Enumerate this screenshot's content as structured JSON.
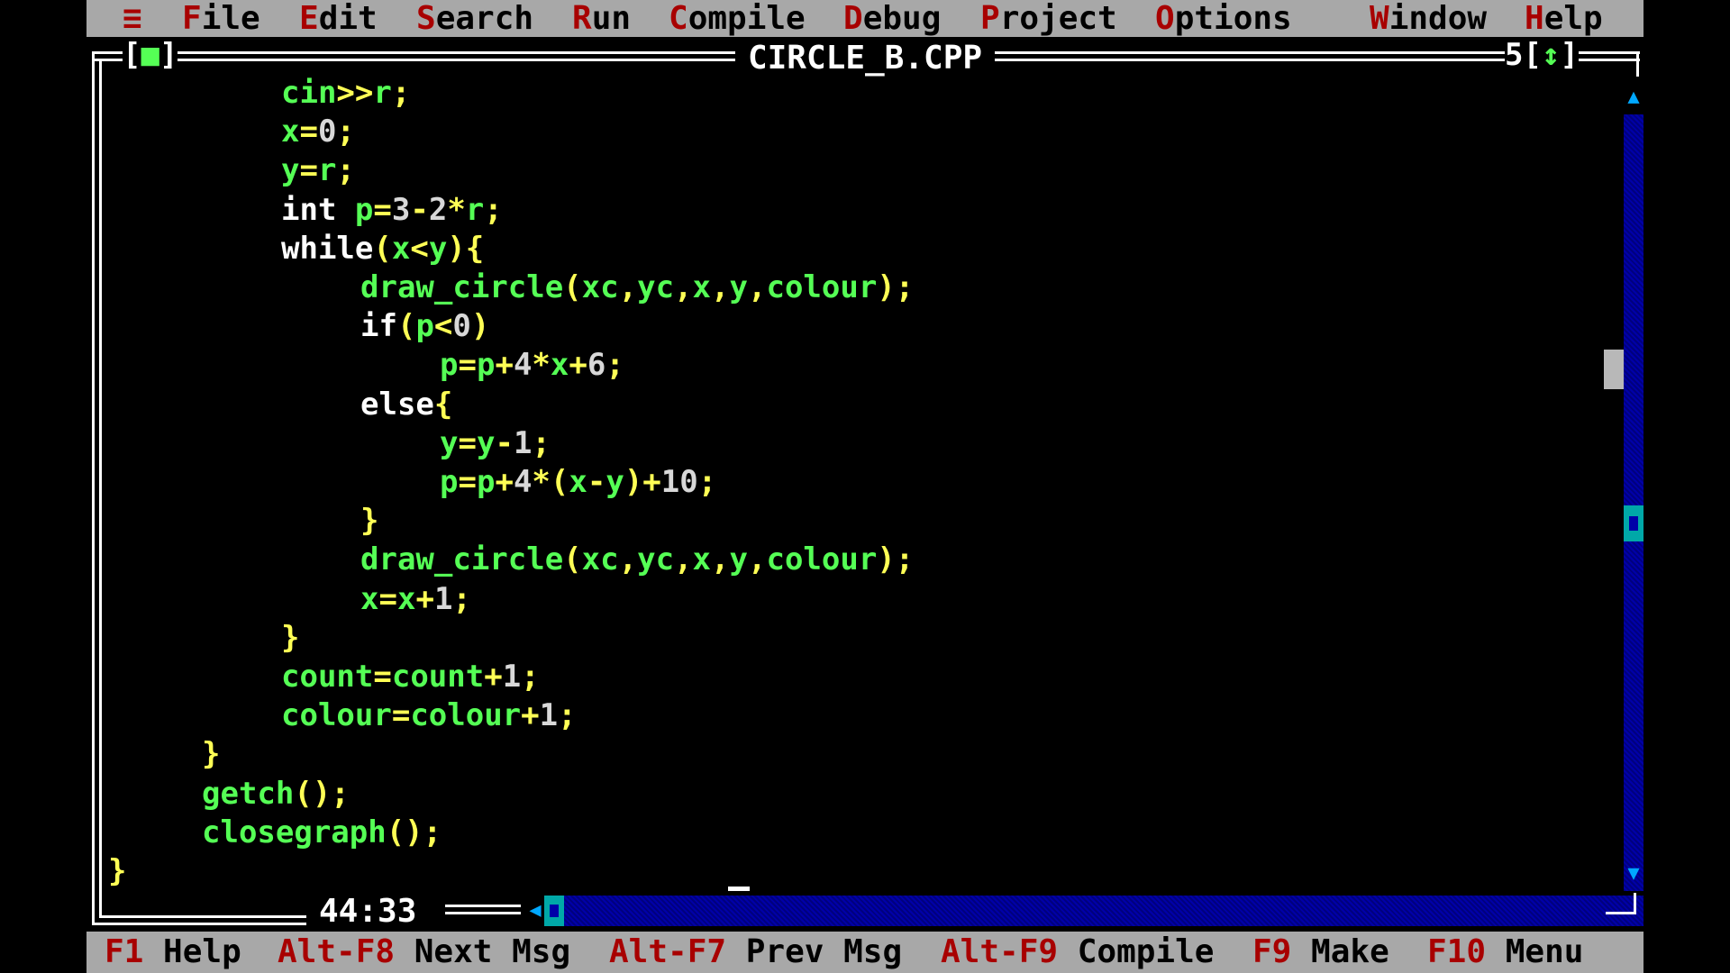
{
  "menu": {
    "system_icon": "≡",
    "items": [
      {
        "hot": "F",
        "rest": "ile"
      },
      {
        "hot": "E",
        "rest": "dit"
      },
      {
        "hot": "S",
        "rest": "earch"
      },
      {
        "hot": "R",
        "rest": "un"
      },
      {
        "hot": "C",
        "rest": "ompile"
      },
      {
        "hot": "D",
        "rest": "ebug"
      },
      {
        "hot": "P",
        "rest": "roject"
      },
      {
        "hot": "O",
        "rest": "ptions"
      },
      {
        "hot": "W",
        "rest": "indow"
      },
      {
        "hot": "H",
        "rest": "elp"
      }
    ]
  },
  "window": {
    "title": "CIRCLE_B.CPP",
    "close_box_left": "[",
    "close_box_glyph": "■",
    "close_box_right": "]",
    "number": "5",
    "zoom_box_left": "[",
    "zoom_box_glyph": "↕",
    "zoom_box_right": "]"
  },
  "code": [
    {
      "tokens": [
        [
          "id",
          "cin"
        ],
        [
          "op",
          ">>"
        ],
        [
          "id",
          "r"
        ],
        [
          "op",
          ";"
        ]
      ]
    },
    {
      "tokens": [
        [
          "id",
          "x"
        ],
        [
          "op",
          "="
        ],
        [
          "num",
          "0"
        ],
        [
          "op",
          ";"
        ]
      ]
    },
    {
      "tokens": [
        [
          "id",
          "y"
        ],
        [
          "op",
          "="
        ],
        [
          "id",
          "r"
        ],
        [
          "op",
          ";"
        ]
      ]
    },
    {
      "tokens": [
        [
          "kw",
          "int "
        ],
        [
          "id",
          "p"
        ],
        [
          "op",
          "="
        ],
        [
          "num",
          "3"
        ],
        [
          "op",
          "-"
        ],
        [
          "num",
          "2"
        ],
        [
          "op",
          "*"
        ],
        [
          "id",
          "r"
        ],
        [
          "op",
          ";"
        ]
      ]
    },
    {
      "tokens": [
        [
          "kw",
          "while"
        ],
        [
          "op",
          "("
        ],
        [
          "id",
          "x"
        ],
        [
          "op",
          "<"
        ],
        [
          "id",
          "y"
        ],
        [
          "op",
          "){"
        ]
      ]
    },
    {
      "tokens": [
        [
          "id",
          "draw_circle"
        ],
        [
          "op",
          "("
        ],
        [
          "id",
          "xc"
        ],
        [
          "op",
          ","
        ],
        [
          "id",
          "yc"
        ],
        [
          "op",
          ","
        ],
        [
          "id",
          "x"
        ],
        [
          "op",
          ","
        ],
        [
          "id",
          "y"
        ],
        [
          "op",
          ","
        ],
        [
          "id",
          "colour"
        ],
        [
          "op",
          ");"
        ]
      ]
    },
    {
      "tokens": [
        [
          "kw",
          "if"
        ],
        [
          "op",
          "("
        ],
        [
          "id",
          "p"
        ],
        [
          "op",
          "<"
        ],
        [
          "num",
          "0"
        ],
        [
          "op",
          ")"
        ]
      ]
    },
    {
      "tokens": [
        [
          "id",
          "p"
        ],
        [
          "op",
          "="
        ],
        [
          "id",
          "p"
        ],
        [
          "op",
          "+"
        ],
        [
          "num",
          "4"
        ],
        [
          "op",
          "*"
        ],
        [
          "id",
          "x"
        ],
        [
          "op",
          "+"
        ],
        [
          "num",
          "6"
        ],
        [
          "op",
          ";"
        ]
      ]
    },
    {
      "tokens": [
        [
          "kw",
          "else"
        ],
        [
          "op",
          "{"
        ]
      ]
    },
    {
      "tokens": [
        [
          "id",
          "y"
        ],
        [
          "op",
          "="
        ],
        [
          "id",
          "y"
        ],
        [
          "op",
          "-"
        ],
        [
          "num",
          "1"
        ],
        [
          "op",
          ";"
        ]
      ]
    },
    {
      "tokens": [
        [
          "id",
          "p"
        ],
        [
          "op",
          "="
        ],
        [
          "id",
          "p"
        ],
        [
          "op",
          "+"
        ],
        [
          "num",
          "4"
        ],
        [
          "op",
          "*("
        ],
        [
          "id",
          "x"
        ],
        [
          "op",
          "-"
        ],
        [
          "id",
          "y"
        ],
        [
          "op",
          ")+"
        ],
        [
          "num",
          "10"
        ],
        [
          "op",
          ";"
        ]
      ]
    },
    {
      "tokens": [
        [
          "op",
          "}"
        ]
      ]
    },
    {
      "tokens": [
        [
          "id",
          "draw_circle"
        ],
        [
          "op",
          "("
        ],
        [
          "id",
          "xc"
        ],
        [
          "op",
          ","
        ],
        [
          "id",
          "yc"
        ],
        [
          "op",
          ","
        ],
        [
          "id",
          "x"
        ],
        [
          "op",
          ","
        ],
        [
          "id",
          "y"
        ],
        [
          "op",
          ","
        ],
        [
          "id",
          "colour"
        ],
        [
          "op",
          ");"
        ]
      ]
    },
    {
      "tokens": [
        [
          "id",
          "x"
        ],
        [
          "op",
          "="
        ],
        [
          "id",
          "x"
        ],
        [
          "op",
          "+"
        ],
        [
          "num",
          "1"
        ],
        [
          "op",
          ";"
        ]
      ]
    },
    {
      "tokens": [
        [
          "op",
          "}"
        ]
      ]
    },
    {
      "tokens": [
        [
          "id",
          "count"
        ],
        [
          "op",
          "="
        ],
        [
          "id",
          "count"
        ],
        [
          "op",
          "+"
        ],
        [
          "num",
          "1"
        ],
        [
          "op",
          ";"
        ]
      ]
    },
    {
      "tokens": [
        [
          "id",
          "colour"
        ],
        [
          "op",
          "="
        ],
        [
          "id",
          "colour"
        ],
        [
          "op",
          "+"
        ],
        [
          "num",
          "1"
        ],
        [
          "op",
          ";"
        ]
      ]
    },
    {
      "tokens": [
        [
          "op",
          "}"
        ]
      ]
    },
    {
      "tokens": [
        [
          "id",
          "getch"
        ],
        [
          "op",
          "();"
        ]
      ]
    },
    {
      "tokens": [
        [
          "id",
          "closegraph"
        ],
        [
          "op",
          "();"
        ]
      ]
    },
    {
      "tokens": [
        [
          "op",
          "}"
        ]
      ]
    }
  ],
  "cursor_position": "44:33",
  "status": [
    {
      "key": "F1",
      "label": "Help"
    },
    {
      "key": "Alt-F8",
      "label": "Next Msg"
    },
    {
      "key": "Alt-F7",
      "label": "Prev Msg"
    },
    {
      "key": "Alt-F9",
      "label": "Compile"
    },
    {
      "key": "F9",
      "label": "Make"
    },
    {
      "key": "F10",
      "label": "Menu"
    }
  ],
  "colors": {
    "menu_bg": "#a8a8a8",
    "hotkey": "#a80000",
    "identifier": "#55ff55",
    "operator": "#ffff55",
    "keyword": "#ffffff",
    "number": "#d8d8d8",
    "scrollbar": "#0000a8",
    "scroll_thumb": "#00a8a8"
  }
}
